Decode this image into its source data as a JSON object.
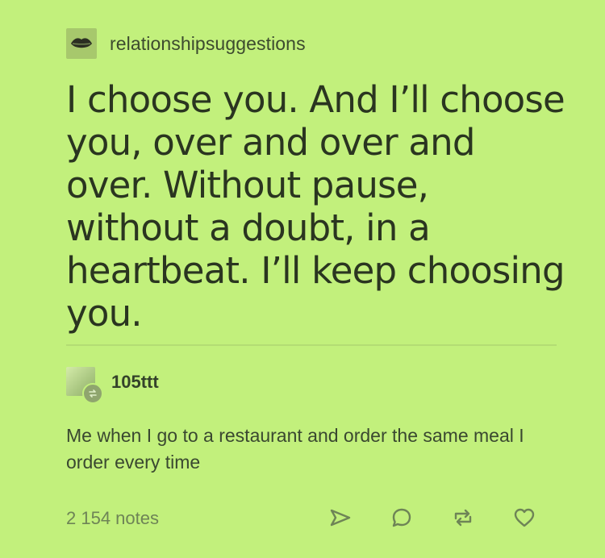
{
  "original_post": {
    "username": "relationshipsuggestions",
    "avatar_icon": "lips-icon",
    "text": "I choose you. And I’ll choose you, over and over and over. Without pause, without a doubt, in a heartbeat. I’ll keep choosing you."
  },
  "reply": {
    "username": "105ttt",
    "avatar_icon": "user-avatar",
    "text": "Me when I go to a restaurant and order the same meal I order every time"
  },
  "footer": {
    "notes": "2 154 notes",
    "actions": [
      {
        "name": "share",
        "icon": "send-icon"
      },
      {
        "name": "reply",
        "icon": "comment-icon"
      },
      {
        "name": "reblog",
        "icon": "reblog-icon"
      },
      {
        "name": "like",
        "icon": "heart-icon"
      }
    ]
  },
  "colors": {
    "background": "#c2f07c",
    "text": "#2a3520",
    "muted": "#6e8456"
  }
}
